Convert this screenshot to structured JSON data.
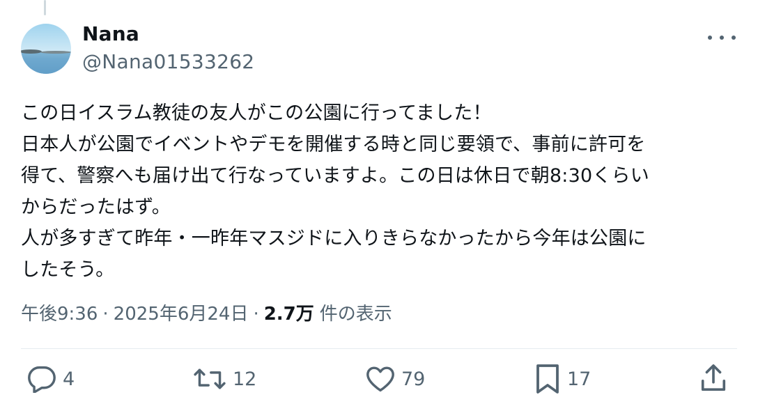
{
  "author": {
    "name": "Nana",
    "handle": "@Nana01533262"
  },
  "post": {
    "text": "この日イスラム教徒の友人がこの公園に行ってました！\n日本人が公園でイベントやデモを開催する時と同じ要領で、事前に許可を\n得て、警察へも届け出て行なっていますよ。この日は休日で朝8:30くらい\nからだったはず。\n人が多すぎて昨年・一昨年マスジドに入りきらなかったから今年は公園に\nしたそう。",
    "time": "午後9:36",
    "separator": "·",
    "date": "2025年6月24日",
    "views_count": "2.7万",
    "views_label": "件の表示"
  },
  "actions": {
    "reply_count": "4",
    "repost_count": "12",
    "like_count": "79",
    "bookmark_count": "17"
  },
  "colors": {
    "text": "#0f1419",
    "secondary": "#536471",
    "divider": "#e6ecf0"
  },
  "icons": [
    "reply-icon",
    "repost-icon",
    "like-icon",
    "bookmark-icon",
    "share-icon",
    "more-icon"
  ]
}
